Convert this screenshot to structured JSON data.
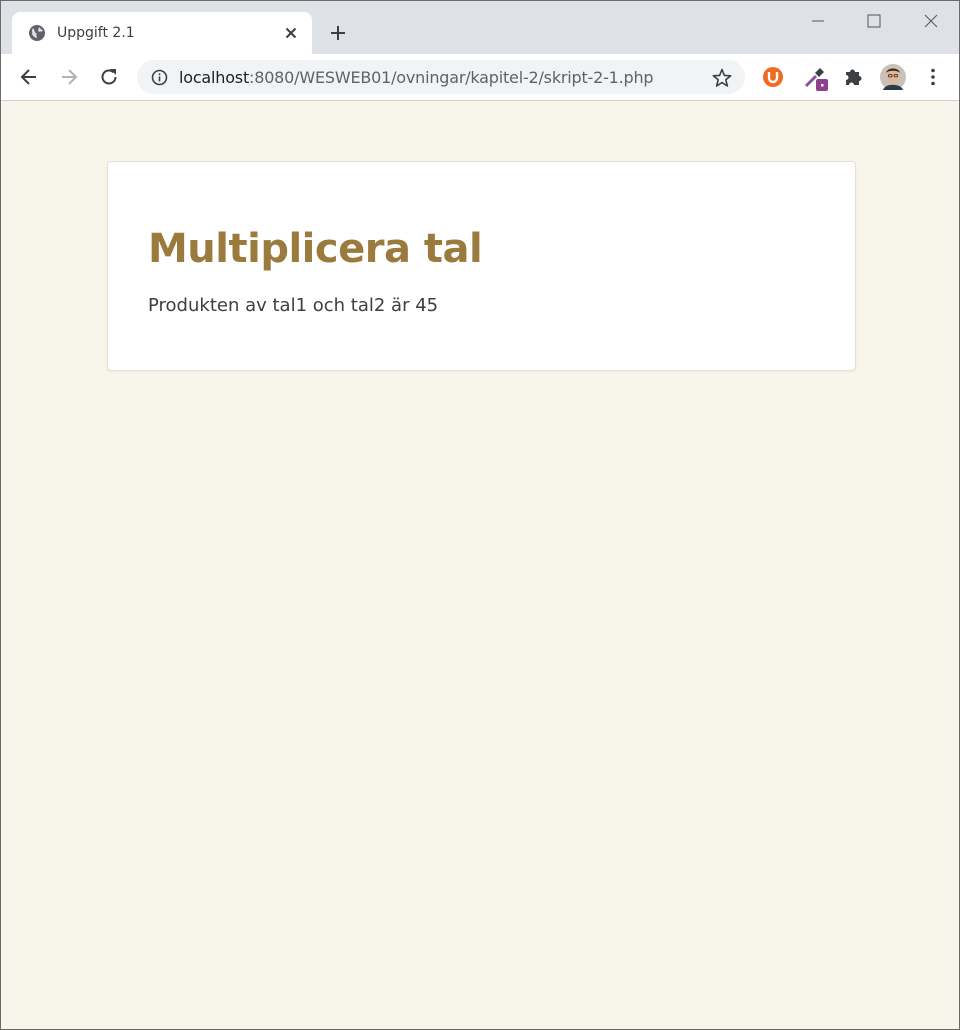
{
  "browser": {
    "tab": {
      "title": "Uppgift 2.1",
      "favicon": "globe-icon"
    },
    "address": {
      "host": "localhost",
      "path": ":8080/WESWEB01/ovningar/kapitel-2/skript-2-1.php"
    },
    "extensions": [
      "ublock-icon",
      "color-picker-icon",
      "puzzle-icon",
      "profile-avatar"
    ],
    "colors": {
      "tabstrip": "#dee1e6",
      "omnibox": "#f1f3f4",
      "accent": "#1a73e8"
    }
  },
  "page": {
    "heading": "Multiplicera tal",
    "result": "Produkten av tal1 och tal2 är 45",
    "colors": {
      "background": "#f8f5ea",
      "heading": "#9a7b3d",
      "text": "#3e3e3e"
    }
  }
}
